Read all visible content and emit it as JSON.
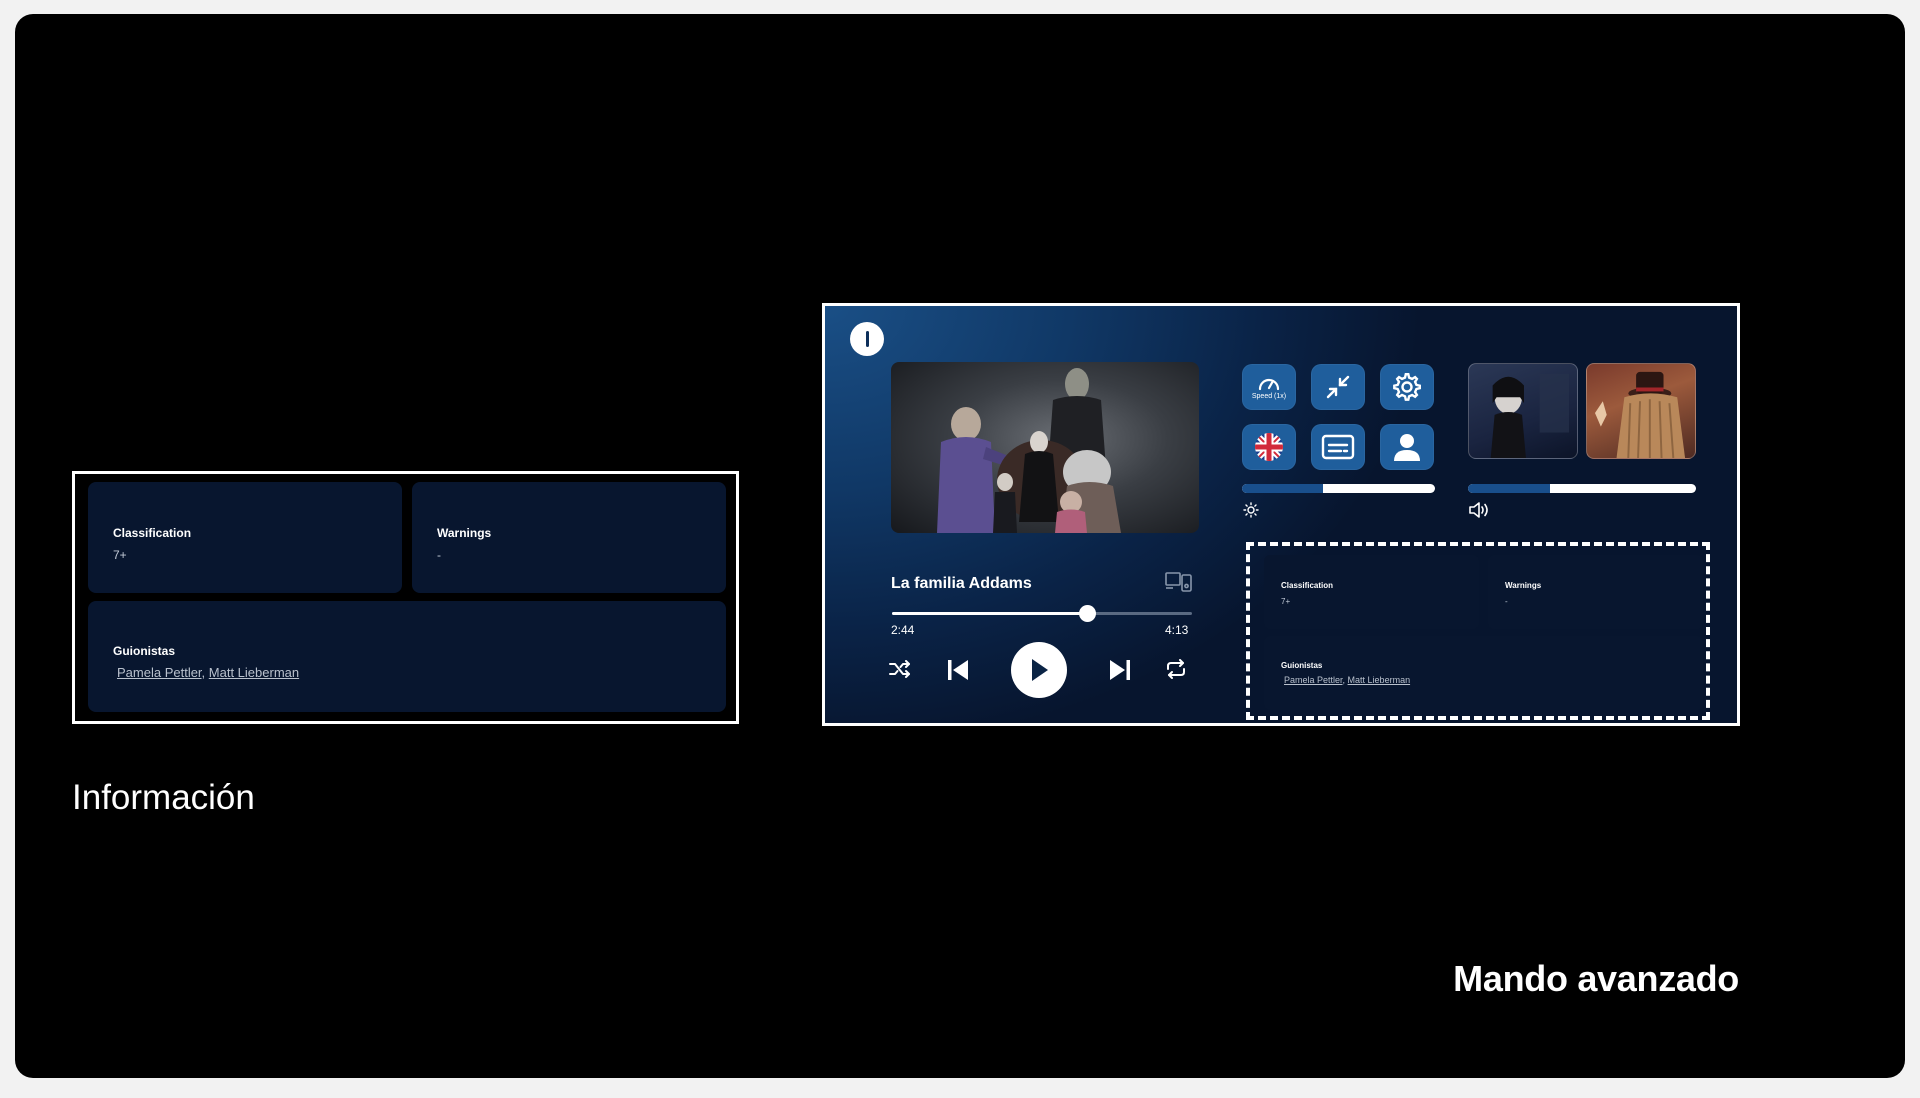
{
  "captions": {
    "left": "Información",
    "right": "Mando avanzado"
  },
  "info": {
    "classification_label": "Classification",
    "classification_value": "7+",
    "warnings_label": "Warnings",
    "warnings_value": "-",
    "writers_label": "Guionistas",
    "writers": [
      "Pamela Pettler",
      "Matt Lieberman"
    ],
    "writers_separator": ", "
  },
  "player": {
    "title": "La familia Addams",
    "current_time": "2:44",
    "total_time": "4:13",
    "progress": 0.65,
    "speed_caption": "Speed (1x)"
  },
  "levels": {
    "brightness": 0.42,
    "volume": 0.36
  },
  "colors": {
    "tile": "#1f5e9c",
    "card": "#08162f",
    "slider_fill": "#194f8c"
  },
  "icons": {
    "power": "power-icon",
    "speed": "speedometer-icon",
    "shrink": "minimize-arrows-icon",
    "settings": "gear-icon",
    "language": "uk-flag-icon",
    "subtitles": "subtitles-icon",
    "profile": "user-icon",
    "brightness": "sun-icon",
    "volume": "speaker-icon",
    "cast": "cast-devices-icon"
  }
}
